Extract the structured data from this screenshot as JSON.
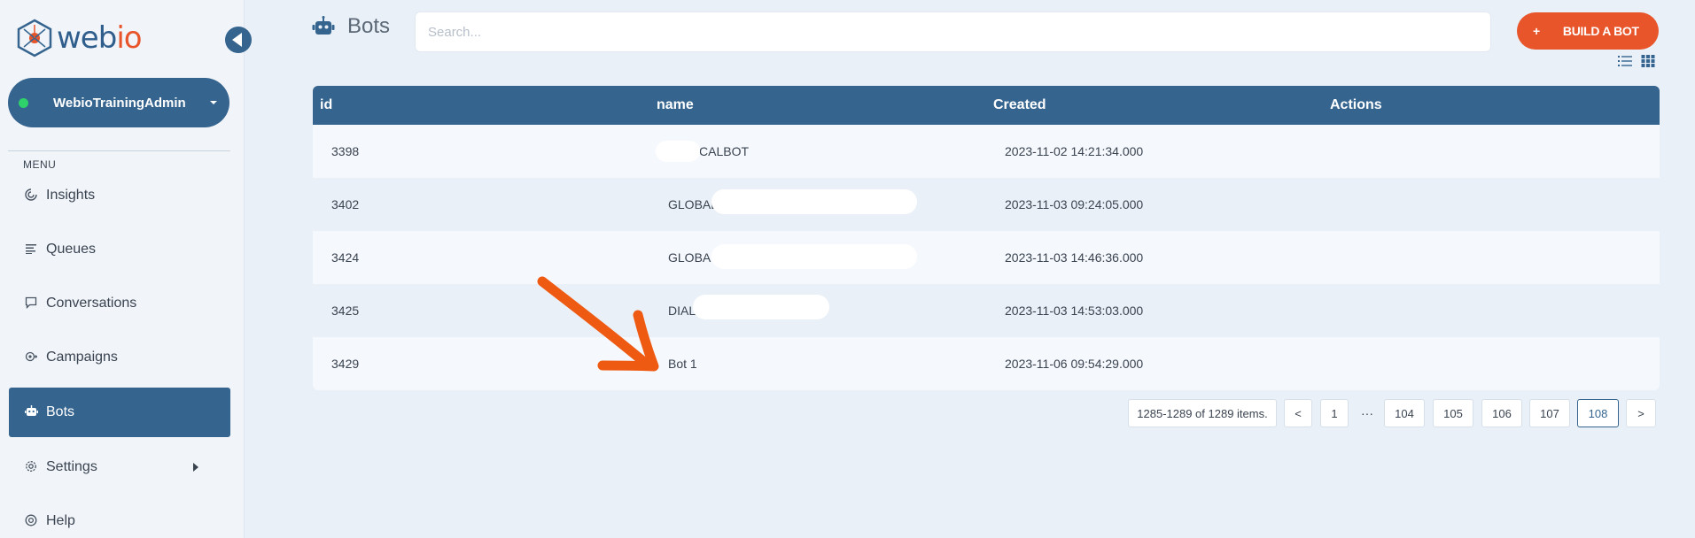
{
  "app": {
    "logo_text_main": "web",
    "logo_text_accent": "io"
  },
  "colors": {
    "brand_blue": "#35648f",
    "accent_orange": "#e8552a",
    "online_green": "#2fd16a"
  },
  "sidebar": {
    "account_name": "WebioTrainingAdmin",
    "menu_label": "MENU",
    "items": [
      {
        "label": "Insights",
        "icon": "insights-icon"
      },
      {
        "label": "Queues",
        "icon": "queues-icon"
      },
      {
        "label": "Conversations",
        "icon": "chat-bubble-icon"
      },
      {
        "label": "Campaigns",
        "icon": "campaigns-icon"
      },
      {
        "label": "Bots",
        "icon": "robot-icon",
        "active": true
      },
      {
        "label": "Settings",
        "icon": "gear-icon"
      },
      {
        "label": "Help",
        "icon": "help-icon"
      }
    ]
  },
  "header": {
    "title": "Bots",
    "search_placeholder": "Search...",
    "build_button_plus": "+",
    "build_button_label": "BUILD A BOT"
  },
  "table": {
    "columns": [
      "id",
      "name",
      "Created",
      "Actions"
    ],
    "rows": [
      {
        "id": "3398",
        "name": "CALBOT",
        "created": "2023-11-02 14:21:34.000"
      },
      {
        "id": "3402",
        "name": "GLOBAL",
        "created": "2023-11-03 09:24:05.000"
      },
      {
        "id": "3424",
        "name": "GLOBA",
        "created": "2023-11-03 14:46:36.000"
      },
      {
        "id": "3425",
        "name": "DIAL",
        "created": "2023-11-03 14:53:03.000"
      },
      {
        "id": "3429",
        "name": "Bot 1",
        "created": "2023-11-06 09:54:29.000"
      }
    ]
  },
  "pagination": {
    "info": "1285-1289 of 1289 items.",
    "prev": "<",
    "first": "1",
    "ellipsis": "···",
    "pages": [
      "104",
      "105",
      "106",
      "107",
      "108"
    ],
    "current": "108",
    "next": ">"
  }
}
